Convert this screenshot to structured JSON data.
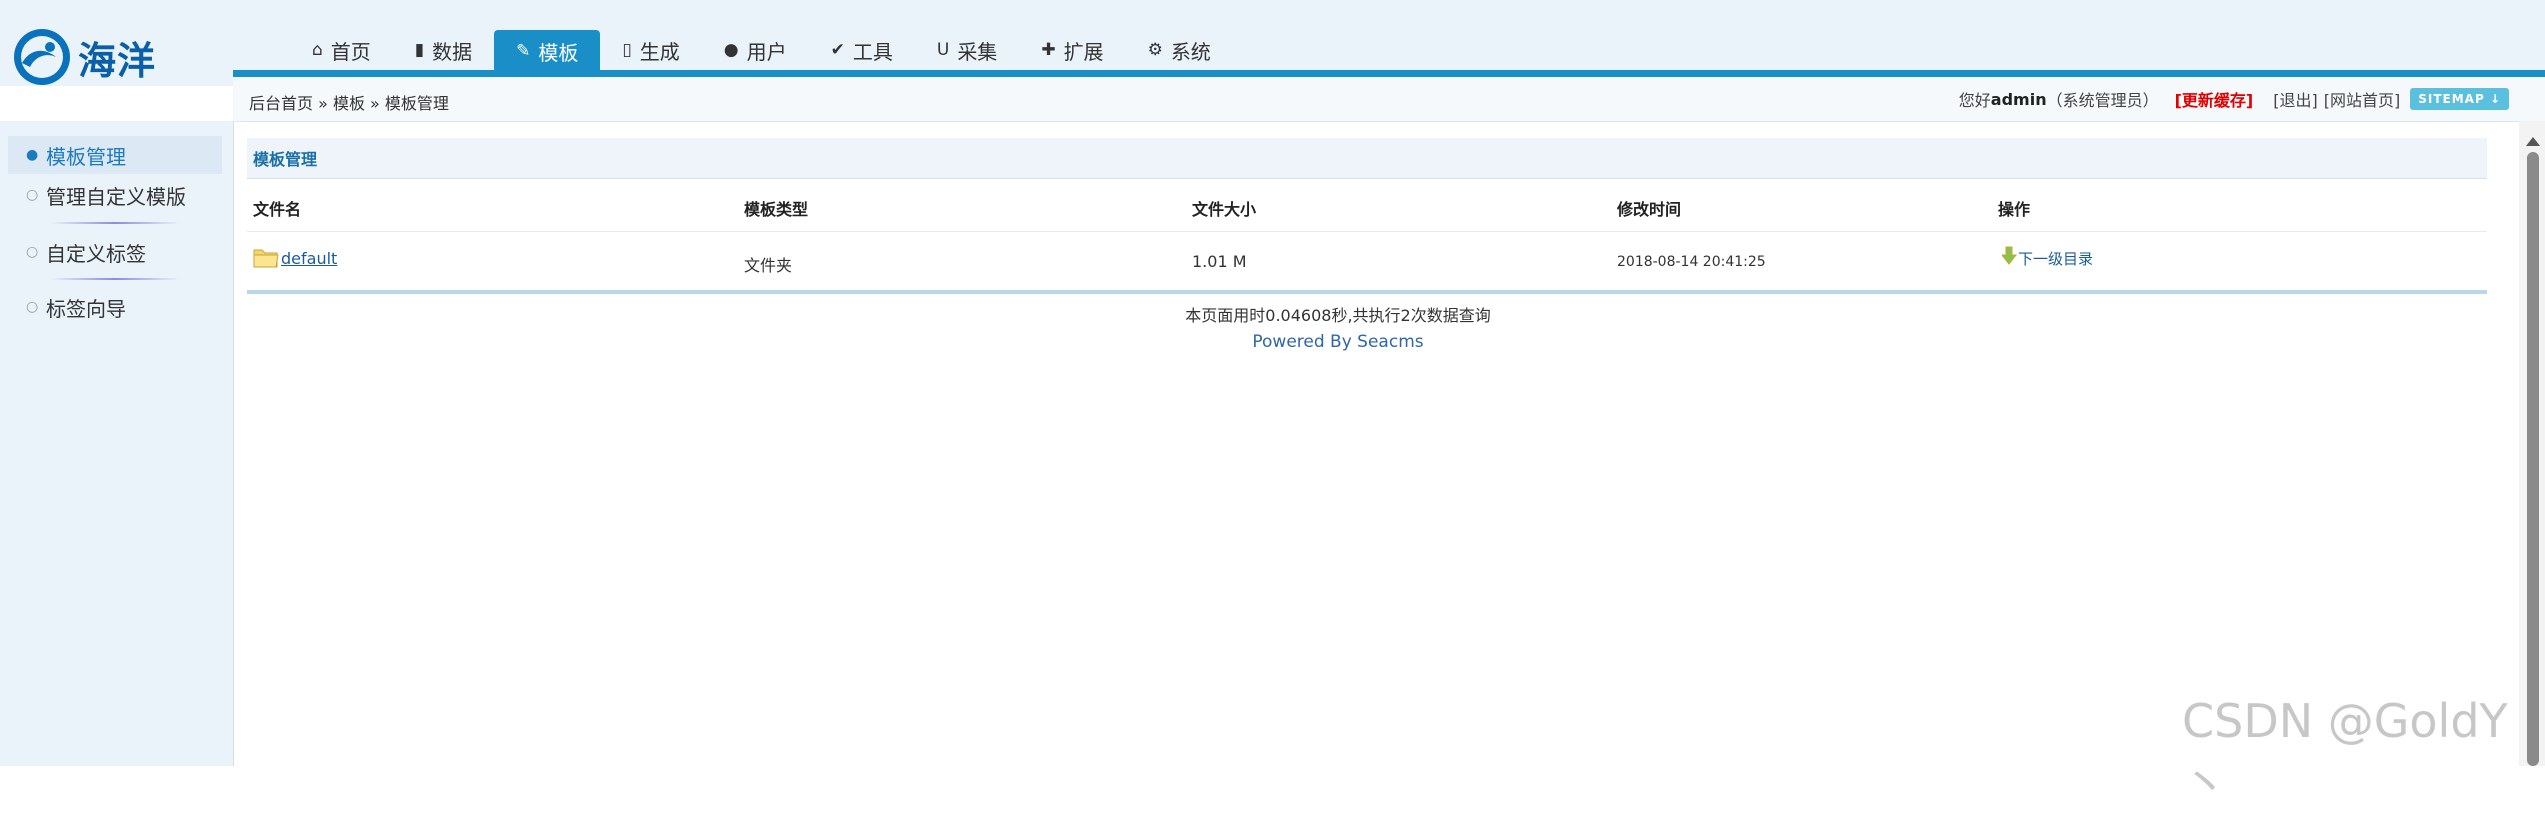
{
  "logo": {
    "text": "海洋"
  },
  "nav": [
    {
      "label": "首页",
      "icon": "home-icon",
      "glyph": "⌂"
    },
    {
      "label": "数据",
      "icon": "book-icon",
      "glyph": "▮"
    },
    {
      "label": "模板",
      "icon": "edit-icon",
      "glyph": "✎"
    },
    {
      "label": "生成",
      "icon": "file-icon",
      "glyph": "▯"
    },
    {
      "label": "用户",
      "icon": "user-icon",
      "glyph": "●"
    },
    {
      "label": "工具",
      "icon": "wrench-icon",
      "glyph": "✔"
    },
    {
      "label": "采集",
      "icon": "magnet-icon",
      "glyph": "U"
    },
    {
      "label": "扩展",
      "icon": "puzzle-icon",
      "glyph": "✚"
    },
    {
      "label": "系统",
      "icon": "gear-icon",
      "glyph": "⚙"
    }
  ],
  "active_nav": "模板",
  "breadcrumb": "后台首页 » 模板 » 模板管理",
  "user": {
    "greeting": "您好",
    "name": "admin",
    "role": "（系统管理员）",
    "refresh": "[更新缓存]",
    "logout": "[退出]",
    "site_home": "[网站首页]",
    "sitemap": "SITEMAP ↓"
  },
  "sidebar": {
    "items": [
      {
        "label": "模板管理",
        "active": true
      },
      {
        "label": "管理自定义模版",
        "active": false
      },
      {
        "label": "自定义标签",
        "active": false
      },
      {
        "label": "标签向导",
        "active": false
      }
    ]
  },
  "panel": {
    "title": "模板管理",
    "columns": [
      "文件名",
      "模板类型",
      "文件大小",
      "修改时间",
      "操作"
    ],
    "rows": [
      {
        "name": "default",
        "type": "文件夹",
        "size": "1.01 M",
        "modified": "2018-08-14 20:41:25",
        "action": "下一级目录"
      }
    ]
  },
  "footer": {
    "stats": "本页面用时0.04608秒,共执行2次数据查询",
    "powered": "Powered By Seacms"
  },
  "watermark": "CSDN @GoldY丶",
  "colors": {
    "accent": "#1a8fc7",
    "refresh": "#e00000",
    "link": "#1a5c9a"
  }
}
